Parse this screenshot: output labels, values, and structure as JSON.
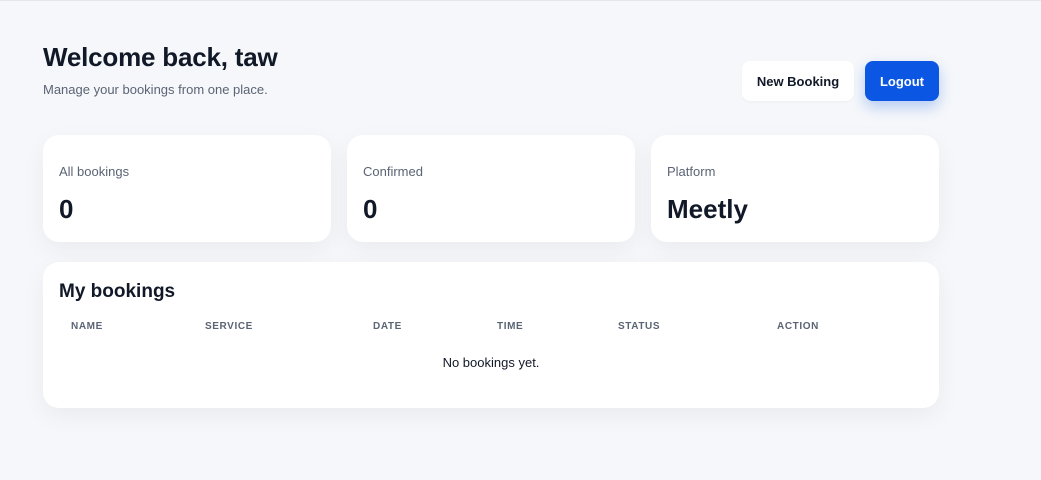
{
  "header": {
    "welcome": "Welcome back, taw",
    "subtitle": "Manage your bookings from one place.",
    "new_booking_label": "New Booking",
    "logout_label": "Logout"
  },
  "stats": [
    {
      "label": "All bookings",
      "value": "0"
    },
    {
      "label": "Confirmed",
      "value": "0"
    },
    {
      "label": "Platform",
      "value": "Meetly"
    }
  ],
  "bookings": {
    "title": "My bookings",
    "columns": [
      "NAME",
      "SERVICE",
      "DATE",
      "TIME",
      "STATUS",
      "ACTION"
    ],
    "empty_text": "No bookings yet."
  },
  "colors": {
    "background": "#f5f7fa",
    "accent": "#0b57e3",
    "muted_text": "#5b6474"
  }
}
